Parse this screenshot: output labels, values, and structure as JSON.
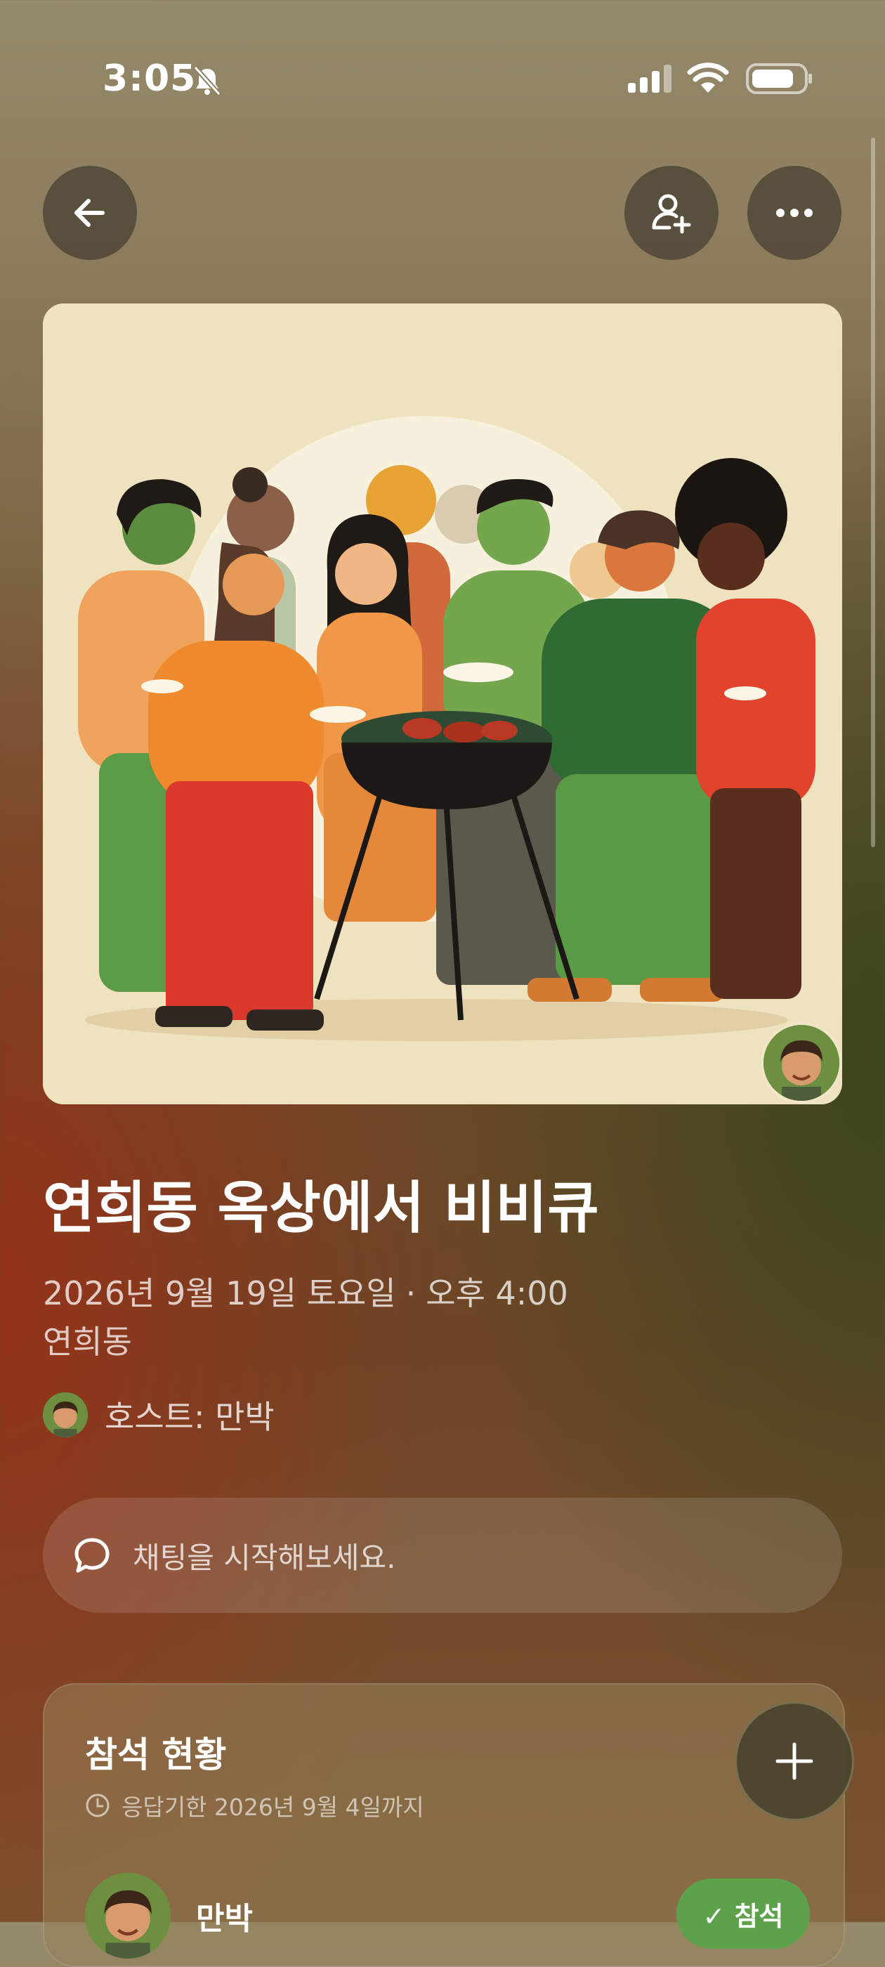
{
  "status_bar": {
    "time": "3:05"
  },
  "event": {
    "title": "연희동 옥상에서 비비큐",
    "date": "2026년 9월 19일 토요일",
    "separator": "·",
    "time": "오후 4:00",
    "location": "연희동",
    "host_label": "호스트: 만박"
  },
  "chat": {
    "placeholder": "채팅을 시작해보세요."
  },
  "rsvp": {
    "title": "참석 현황",
    "deadline": "응답기한 2026년 9월 4일까지",
    "attendees": [
      {
        "name": "만박",
        "status": "✓ 참석"
      }
    ]
  },
  "icons": {
    "back": "arrow-left-icon",
    "add_user": "add-user-icon",
    "more": "more-horizontal-icon",
    "chat": "chat-bubble-icon",
    "clock": "clock-icon",
    "add": "plus-icon"
  },
  "colors": {
    "accept_green": "#5da24a"
  }
}
